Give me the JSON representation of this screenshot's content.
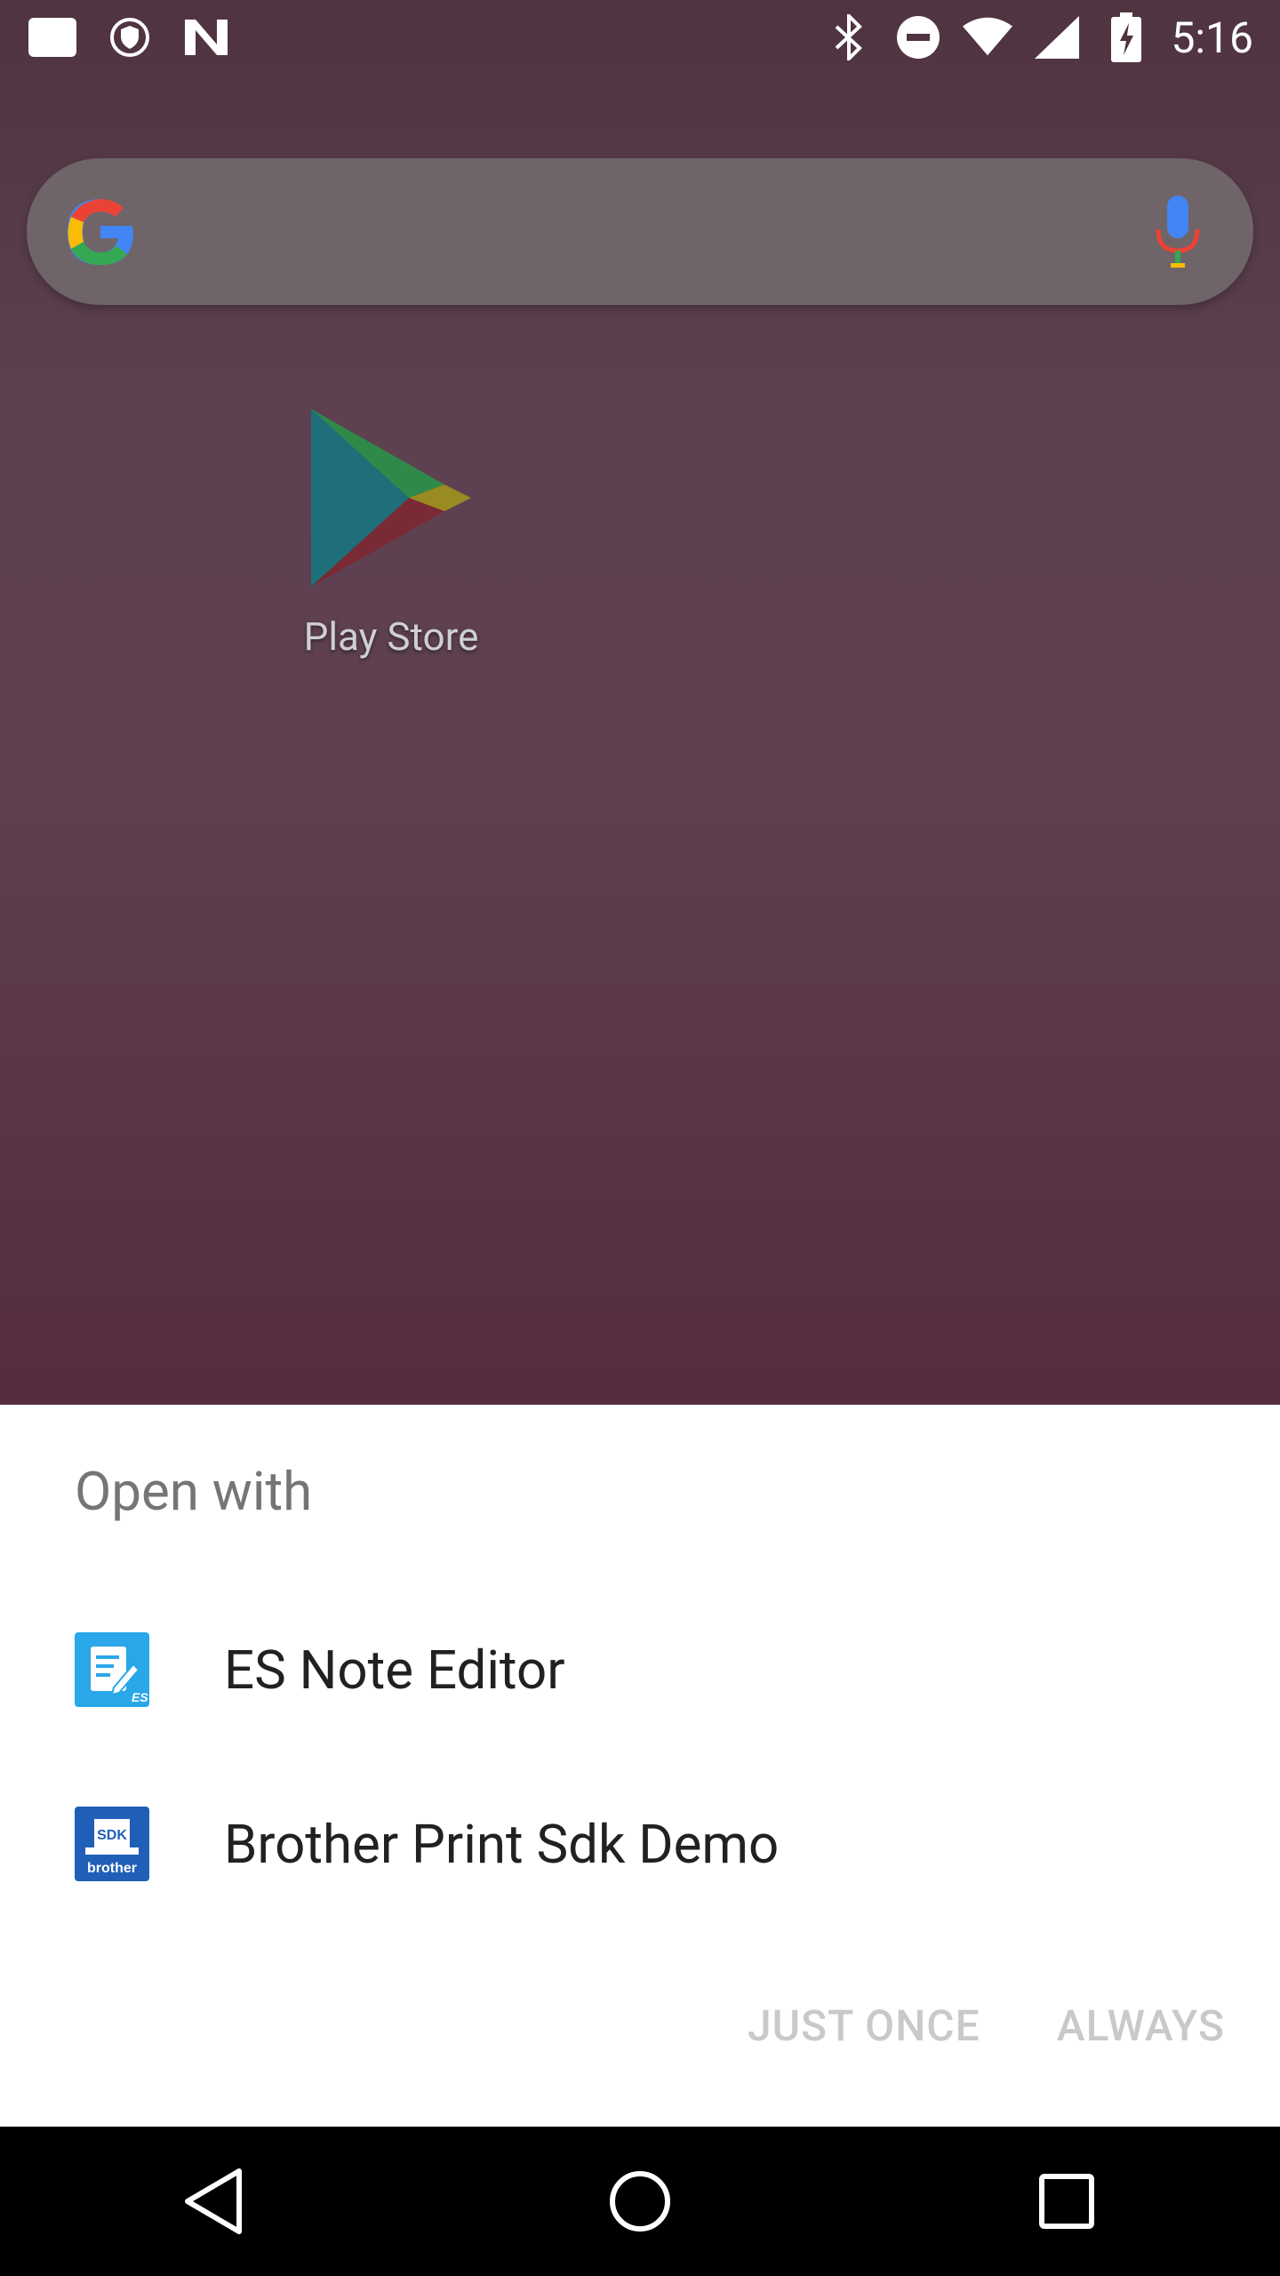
{
  "status_bar": {
    "time": "5:16",
    "icons_left": [
      "notification-square-icon",
      "vpn-shield-icon",
      "n-logo-icon"
    ],
    "icons_right": [
      "bluetooth-icon",
      "do-not-disturb-icon",
      "wifi-icon",
      "signal-icon",
      "battery-icon"
    ]
  },
  "home": {
    "search_bar": {
      "logo": "google-g-icon",
      "mic": "mic-icon"
    },
    "app": {
      "label": "Play Store",
      "icon": "play-store-icon"
    }
  },
  "dialog": {
    "title": "Open with",
    "apps": [
      {
        "label": "ES Note Editor",
        "icon": "es-note-editor-icon",
        "icon_color": "#29a7e8"
      },
      {
        "label": "Brother Print Sdk Demo",
        "icon": "brother-sdk-icon",
        "icon_color": "#1f5fb7",
        "icon_text_top": "SDK",
        "icon_text_bottom": "brother"
      }
    ],
    "buttons": {
      "just_once": "JUST ONCE",
      "always": "ALWAYS"
    }
  },
  "nav_bar": {
    "back": "back-icon",
    "home": "home-icon",
    "recents": "recents-icon"
  }
}
